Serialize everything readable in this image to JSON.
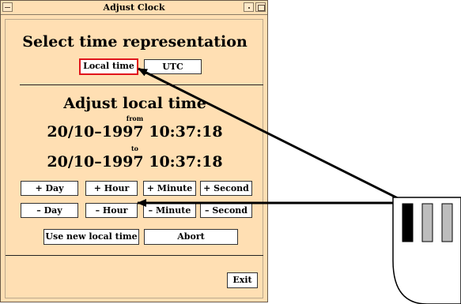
{
  "window": {
    "title": "Adjust Clock"
  },
  "representation": {
    "heading": "Select time representation",
    "local_label": "Local time",
    "utc_label": "UTC"
  },
  "adjust": {
    "heading": "Adjust local time",
    "from_label": "from",
    "from_value": "20/10–1997 10:37:18",
    "to_label": "to",
    "to_value": "20/10–1997 10:37:18"
  },
  "increment_buttons": [
    "+ Day",
    "+ Hour",
    "+ Minute",
    "+ Second"
  ],
  "decrement_buttons": [
    "– Day",
    "– Hour",
    "– Minute",
    "– Second"
  ],
  "actions": {
    "use_new": "Use new local time",
    "abort": "Abort",
    "exit": "Exit"
  },
  "colors": {
    "window_bg": "#ffdfb3",
    "selection_border": "#e0141c",
    "input_key_black": "#000000",
    "input_key_gray": "#bdbdbd"
  }
}
